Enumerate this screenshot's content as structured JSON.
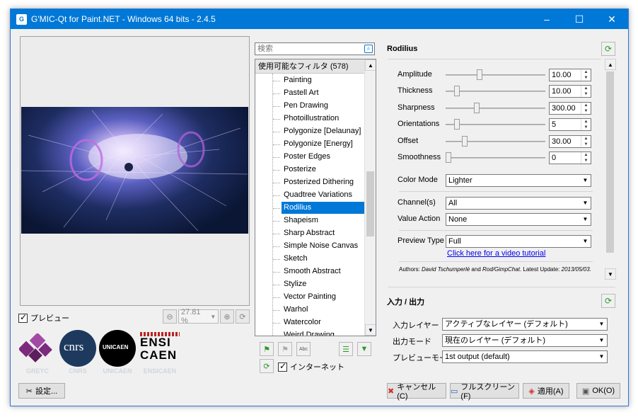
{
  "window": {
    "title": "G'MIC-Qt for Paint.NET - Windows 64 bits - 2.4.5",
    "app_icon": "G"
  },
  "titlebar_controls": {
    "minimize": "–",
    "maximize": "☐",
    "close": "✕"
  },
  "preview": {
    "checkbox_label": "プレビュー",
    "zoom_value": "27.81 %"
  },
  "logos": [
    "GREYC",
    "CNRS",
    "UNICAEN",
    "ENSICAEN"
  ],
  "logo_text": {
    "cnrs": "cnrs",
    "unicaen": "UNICAEN",
    "ensi": "ENSI",
    "caen": "CAEN"
  },
  "settings_button": "設定...",
  "filter_list": {
    "search_placeholder": "検索",
    "header": "使用可能なフィルタ (578)",
    "items": [
      "Painting",
      "Pastell Art",
      "Pen Drawing",
      "Photoillustration",
      "Polygonize [Delaunay]",
      "Polygonize [Energy]",
      "Poster Edges",
      "Posterize",
      "Posterized Dithering",
      "Quadtree Variations",
      "Rodilius",
      "Shapeism",
      "Sharp Abstract",
      "Simple Noise Canvas",
      "Sketch",
      "Smooth Abstract",
      "Stylize",
      "Vector Painting",
      "Warhol",
      "Watercolor",
      "Weird Drawing"
    ],
    "selected": "Rodilius",
    "internet_label": "インターネット"
  },
  "filter": {
    "name": "Rodilius",
    "params": [
      {
        "label": "Amplitude",
        "value": "10.00",
        "fraction": 0.33
      },
      {
        "label": "Thickness",
        "value": "10.00",
        "fraction": 0.09
      },
      {
        "label": "Sharpness",
        "value": "300.00",
        "fraction": 0.3
      },
      {
        "label": "Orientations",
        "value": "5",
        "fraction": 0.09
      },
      {
        "label": "Offset",
        "value": "30.00",
        "fraction": 0.17
      },
      {
        "label": "Smoothness",
        "value": "0",
        "fraction": 0.0
      }
    ],
    "color_mode": {
      "label": "Color Mode",
      "value": "Lighter"
    },
    "channels": {
      "label": "Channel(s)",
      "value": "All"
    },
    "value_action": {
      "label": "Value Action",
      "value": "None"
    },
    "preview_type": {
      "label": "Preview Type",
      "value": "Full"
    },
    "tutorial_link": "Click here for a video tutorial",
    "authors_prefix": "Authors: ",
    "author1": "David Tschumperlé",
    "authors_and": " and ",
    "author2": "Rod/GimpChat",
    "update": ". Latest Update: ",
    "update_date": "2013/05/03."
  },
  "io": {
    "title": "入力 / 出力",
    "input_layer": {
      "label": "入力レイヤー",
      "value": "アクティブなレイヤー (デフォルト)"
    },
    "output_mode": {
      "label": "出力モード",
      "value": "現在のレイヤー (デフォルト)"
    },
    "preview_mode": {
      "label": "プレビューモード",
      "value": "1st output (default)"
    }
  },
  "buttons": {
    "cancel": "キャンセル(C)",
    "fullscreen": "フルスクリーン(F)",
    "apply": "適用(A)",
    "ok": "OK(O)"
  },
  "colors": {
    "accent": "#0078d7",
    "selection": "#0078d7",
    "refresh_green": "#2a9a2a"
  }
}
